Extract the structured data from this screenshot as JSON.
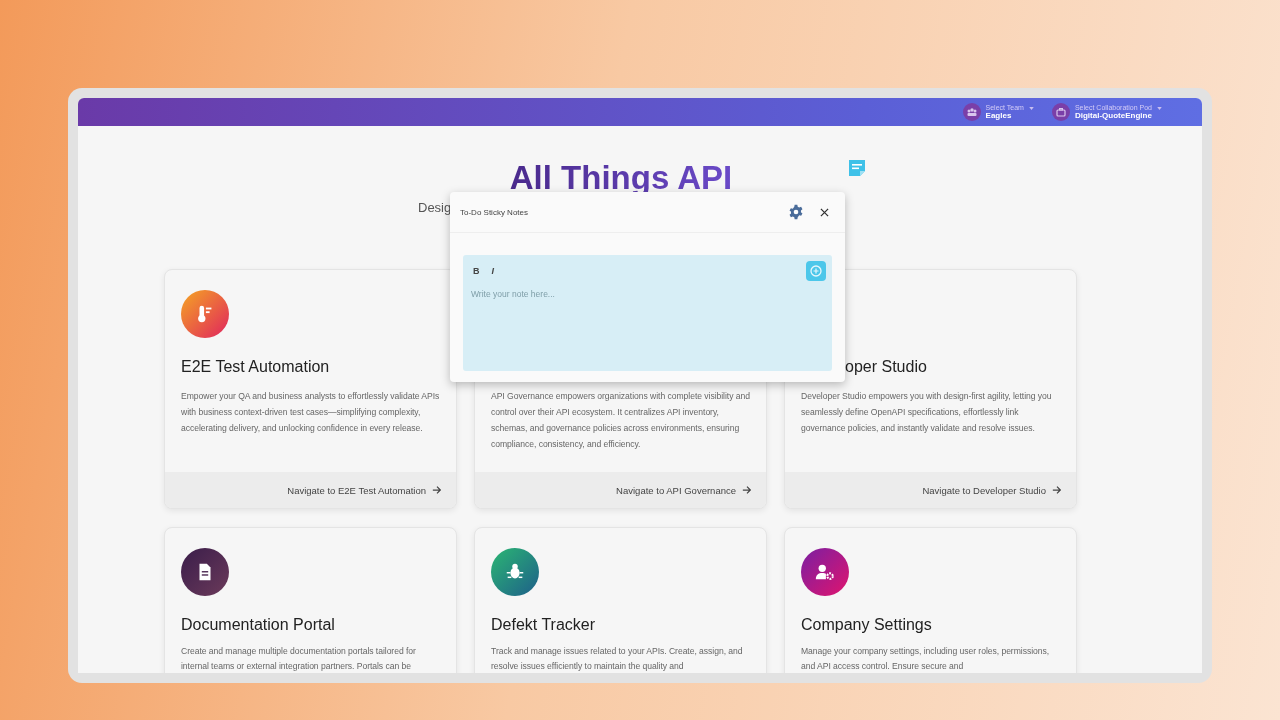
{
  "header": {
    "selectors": [
      {
        "label": "Select Team",
        "value": "Eagles",
        "kind": "team"
      },
      {
        "label": "Select Collaboration Pod",
        "value": "Digital-QuoteEngine",
        "kind": "pod"
      }
    ]
  },
  "hero": {
    "title": "All Things API",
    "subtitle": "Desig"
  },
  "sticky_popup": {
    "title": "To-Do Sticky Notes",
    "format_buttons": [
      {
        "label": "B",
        "kind": "bold"
      },
      {
        "label": "I",
        "kind": "italic"
      }
    ],
    "placeholder": "Write your note here..."
  },
  "cards": [
    {
      "kind": "thermometer",
      "title": "E2E Test Automation",
      "title_cut": false,
      "description": "Empower your QA and business analysts to effortlessly validate APIs with business context-driven test cases—simplifying complexity, accelerating delivery, and unlocking confidence in every release.",
      "link": "Navigate to E2E Test Automation"
    },
    {
      "description": "API Governance empowers organizations with complete visibility and control over their API ecosystem. It centralizes API inventory, schemas, and governance policies across environments, ensuring compliance, consistency, and efficiency.",
      "link": "Navigate to API Governance"
    },
    {
      "title": "oper Studio",
      "title_cut": true,
      "description": "Developer Studio empowers you with design-first agility, letting you seamlessly define OpenAPI specifications, effortlessly link governance policies, and instantly validate and resolve issues.",
      "link": "Navigate to Developer Studio"
    },
    {
      "kind": "document",
      "title": "Documentation Portal",
      "title_cut": false,
      "description": "Create and manage multiple documentation portals tailored for internal teams or external integration partners. Portals can be"
    },
    {
      "kind": "bug",
      "title": "Defekt Tracker",
      "title_cut": false,
      "description": "Track and manage issues related to your APIs. Create, assign, and resolve issues efficiently to maintain the quality and"
    },
    {
      "kind": "user-gear",
      "title": "Company Settings",
      "title_cut": false,
      "description": "Manage your company settings, including user roles, permissions, and API access control. Ensure secure and"
    }
  ]
}
